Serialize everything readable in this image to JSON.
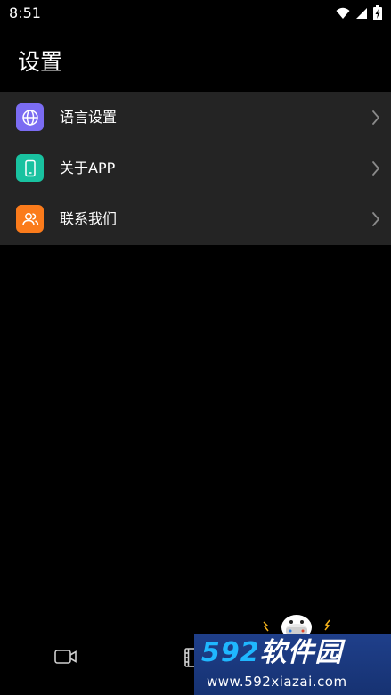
{
  "status_bar": {
    "time": "8:51",
    "icons": [
      "wifi-icon",
      "cellular-signal-icon",
      "battery-charging-icon"
    ]
  },
  "page": {
    "title": "设置"
  },
  "settings": {
    "items": [
      {
        "label": "语言设置",
        "icon": "globe-icon",
        "icon_color": "#7b6cf2"
      },
      {
        "label": "关于APP",
        "icon": "phone-icon",
        "icon_color": "#19c2a0"
      },
      {
        "label": "联系我们",
        "icon": "contacts-icon",
        "icon_color": "#fb7b1b"
      }
    ]
  },
  "bottom_nav": {
    "items": [
      {
        "icon": "video-camera-icon"
      },
      {
        "icon": "film-strip-icon"
      }
    ]
  },
  "watermark": {
    "brand_digits": "592",
    "brand_text": "软件园",
    "url": "www.592xiazai.com"
  },
  "colors": {
    "background": "#000000",
    "list_background": "#242424",
    "text": "#ffffff",
    "chevron": "#8a8a8a"
  }
}
